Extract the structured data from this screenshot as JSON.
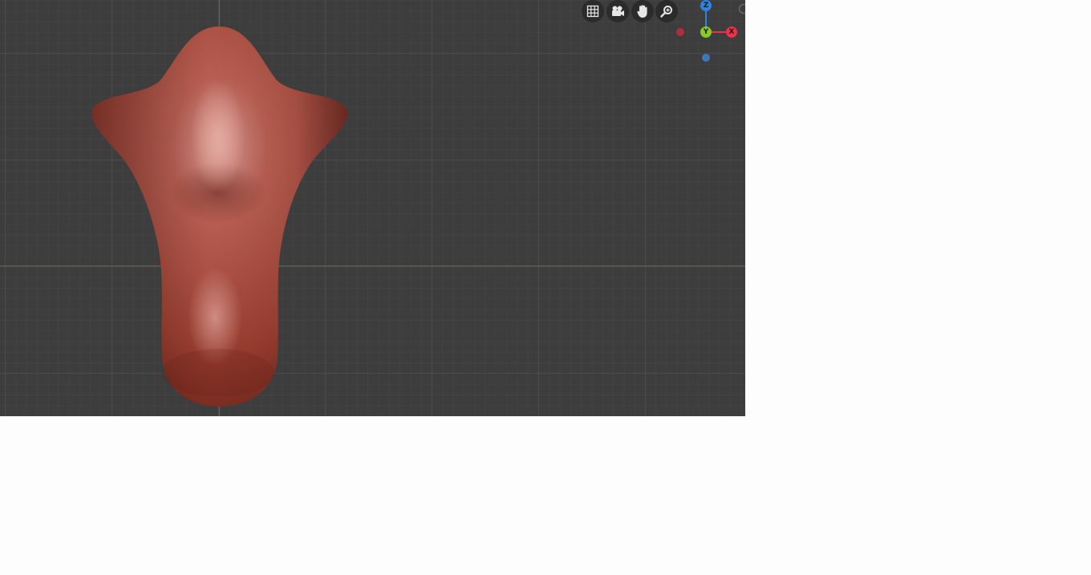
{
  "viewport": {
    "background_color": "#3d3d3d",
    "x_axis_color": "#9a4550",
    "z_axis_color": "#3f6c93"
  },
  "mesh": {
    "color": "#a8493c",
    "highlight_color": "#d49890",
    "shadow_color": "#7a2b20"
  },
  "navigation": {
    "buttons": [
      {
        "name": "grid-icon"
      },
      {
        "name": "camera-icon"
      },
      {
        "name": "hand-pan-icon"
      },
      {
        "name": "zoom-icon"
      }
    ]
  },
  "gizmo": {
    "z_label": "Z",
    "y_label": "Y",
    "x_label": "X",
    "z_color": "#2f83e0",
    "y_color": "#8ac926",
    "x_color": "#e8334a",
    "neg_x_color": "#b02d3e",
    "neg_y_color": "#3f76b8"
  }
}
